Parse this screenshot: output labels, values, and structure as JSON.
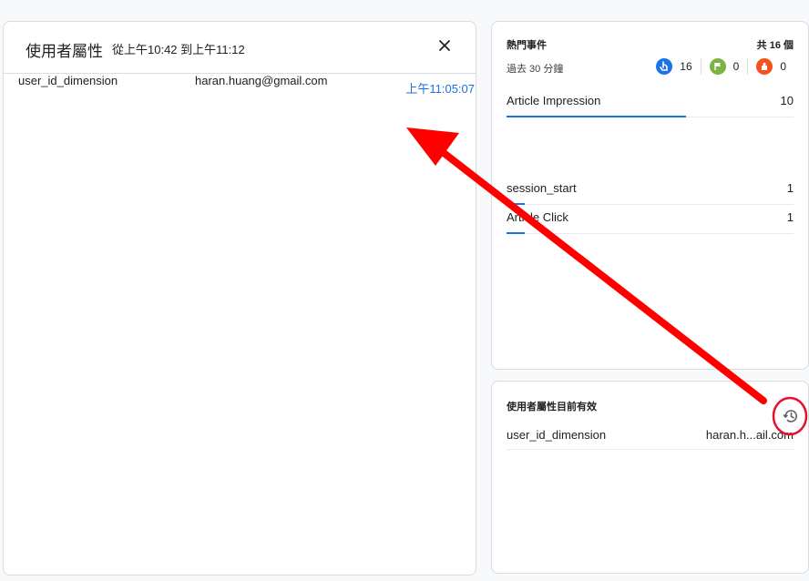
{
  "user_properties_panel": {
    "title": "使用者屬性",
    "time_range": "從上午10:42 到上午11:12",
    "close_icon": "close-icon",
    "rows": [
      {
        "key": "user_id_dimension",
        "value": "haran.huang@gmail.com",
        "time": "上午11:05:07"
      }
    ]
  },
  "top_events": {
    "title": "熱門事件",
    "total": "共 16 個",
    "subtitle": "過去 30 分鐘",
    "stats": [
      {
        "icon": "touch-icon",
        "color": "#1a73e8",
        "value": "16"
      },
      {
        "icon": "flag-icon",
        "color": "#7cb342",
        "value": "0"
      },
      {
        "icon": "conversion-icon",
        "color": "#f4511e",
        "value": "0"
      }
    ],
    "events": [
      {
        "name": "Article Impression",
        "count": "10",
        "fraction": 0.625
      },
      {
        "name": "session_start",
        "count": "1",
        "fraction": 0.0625
      },
      {
        "name": "Article Click",
        "count": "1",
        "fraction": 0.0625
      }
    ]
  },
  "active_props": {
    "title": "使用者屬性目前有效",
    "history_icon": "history-icon",
    "rows": [
      {
        "key": "user_id_dimension",
        "value": "haran.h...ail.com"
      }
    ]
  },
  "annotation": {
    "arrow_color": "#ff0000",
    "circle_color": "#e8112d"
  }
}
